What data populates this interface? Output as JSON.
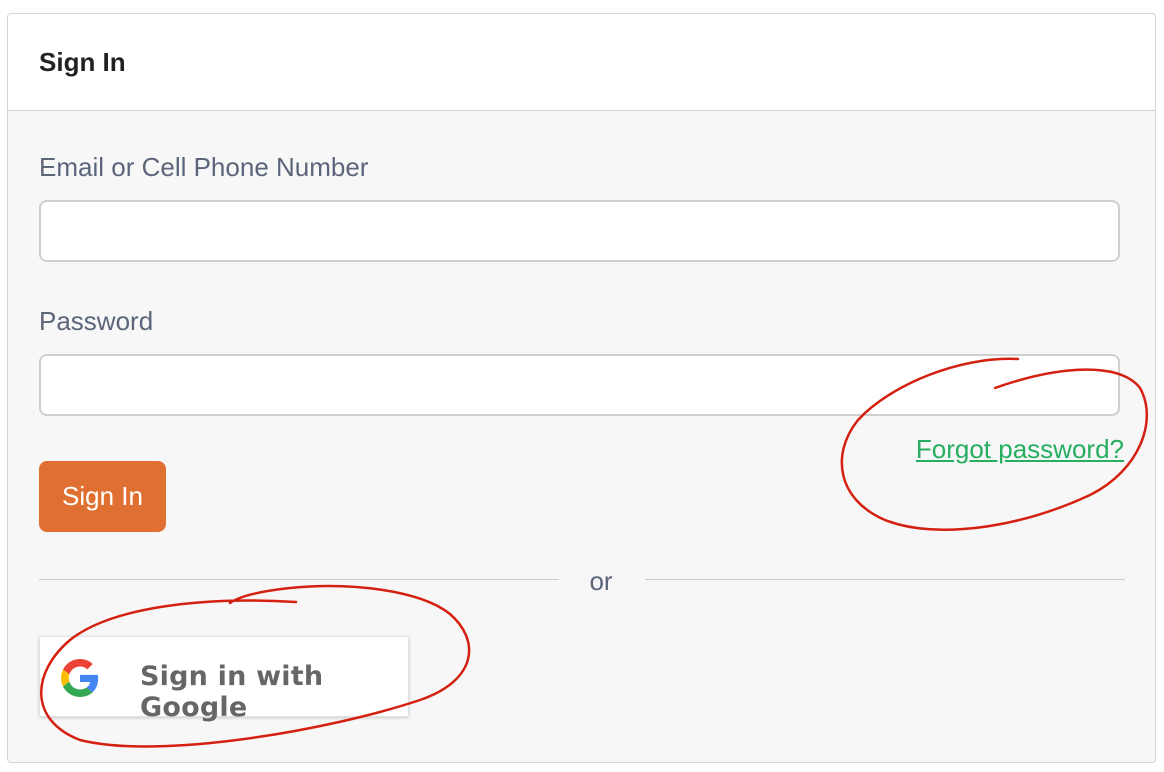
{
  "header": {
    "title": "Sign In"
  },
  "form": {
    "email_label": "Email or Cell Phone Number",
    "email_value": "",
    "password_label": "Password",
    "password_value": "",
    "forgot_password": "Forgot password?",
    "signin_label": "Sign In"
  },
  "divider": {
    "text": "or"
  },
  "google": {
    "label": "Sign in with Google",
    "icon": "google-g-icon"
  },
  "colors": {
    "primary_button": "#e07031",
    "link": "#27ae60",
    "label_text": "#5c667a",
    "annotation": "#d42010"
  }
}
